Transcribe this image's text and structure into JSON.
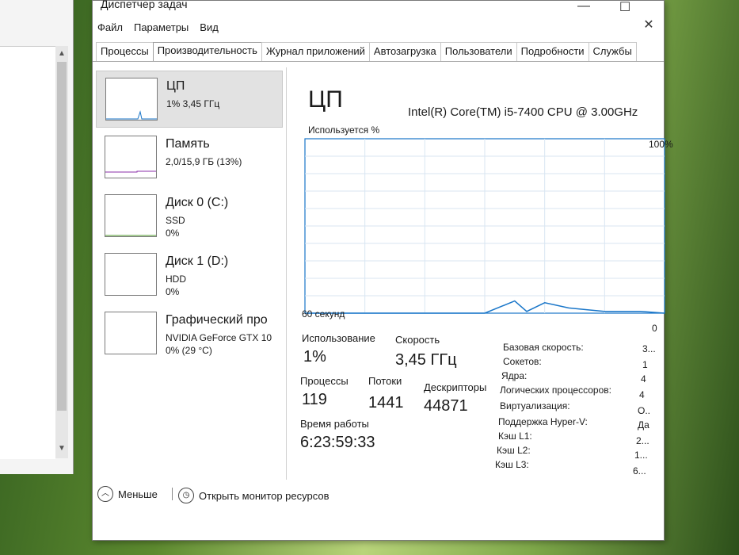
{
  "window": {
    "title": "Диспетчер задач",
    "controls": {
      "minimize": "—",
      "maximize": "☐",
      "close": "✕"
    }
  },
  "menu": [
    "Файл",
    "Параметры",
    "Вид"
  ],
  "tabs": [
    "Процессы",
    "Производительность",
    "Журнал приложений",
    "Автозагрузка",
    "Пользователи",
    "Подробности",
    "Службы"
  ],
  "active_tab": "Производительность",
  "resources": [
    {
      "name": "ЦП",
      "line1": "1% 3,45 ГГц",
      "line2": "",
      "selected": true
    },
    {
      "name": "Память",
      "line1": "2,0/15,9 ГБ (13%)",
      "line2": "",
      "selected": false
    },
    {
      "name": "Диск 0 (C:)",
      "line1": "SSD",
      "line2": "0%",
      "selected": false
    },
    {
      "name": "Диск 1 (D:)",
      "line1": "HDD",
      "line2": "0%",
      "selected": false
    },
    {
      "name": "Графический про",
      "line1": "NVIDIA GeForce GTX 10",
      "line2": "0% (29 °C)",
      "selected": false
    }
  ],
  "detail": {
    "title": "ЦП",
    "model": "Intel(R) Core(TM) i5-7400 CPU @ 3.00GHz",
    "graph_label": "Используется %",
    "graph_max": "100%",
    "graph_min": "0",
    "graph_time": "60 секунд",
    "usage_label": "Использование",
    "usage_value": "1%",
    "speed_label": "Скорость",
    "speed_value": "3,45 ГГц",
    "processes_label": "Процессы",
    "processes_value": "119",
    "threads_label": "Потоки",
    "threads_value": "1441",
    "handles_label": "Дескрипторы",
    "handles_value": "44871",
    "uptime_label": "Время работы",
    "uptime_value": "6:23:59:33",
    "specs": [
      {
        "key": "Базовая скорость:",
        "value": "3..."
      },
      {
        "key": "Сокетов:",
        "value": "1"
      },
      {
        "key": "Ядра:",
        "value": "4"
      },
      {
        "key": "Логических процессоров:",
        "value": "4"
      },
      {
        "key": "Виртуализация:",
        "value": "О.."
      },
      {
        "key": "Поддержка Hyper-V:",
        "value": "Да"
      },
      {
        "key": "Кэш L1:",
        "value": "2..."
      },
      {
        "key": "Кэш L2:",
        "value": "1..."
      },
      {
        "key": "Кэш L3:",
        "value": "6..."
      }
    ]
  },
  "footer": {
    "less_label": "Меньше",
    "less_icon": "chevron-up-icon",
    "monitor_label": "Открыть монитор ресурсов",
    "monitor_icon": "resource-monitor-icon"
  },
  "chart_data": {
    "type": "line",
    "title": "Используется %",
    "xlabel": "60 секунд",
    "ylabel": "",
    "ylim": [
      0,
      100
    ],
    "x": [
      0,
      30,
      35,
      37,
      40,
      44,
      47,
      50,
      53,
      56,
      60
    ],
    "series": [
      {
        "values": [
          0,
          0,
          7,
          1,
          6,
          3,
          2,
          1,
          1,
          1,
          0
        ]
      }
    ],
    "grid": true
  },
  "colors": {
    "graph_line": "#1976c9",
    "graph_grid": "#d9e6f2",
    "graph_border": "#1976c9",
    "selected": "#e2e2e2"
  }
}
